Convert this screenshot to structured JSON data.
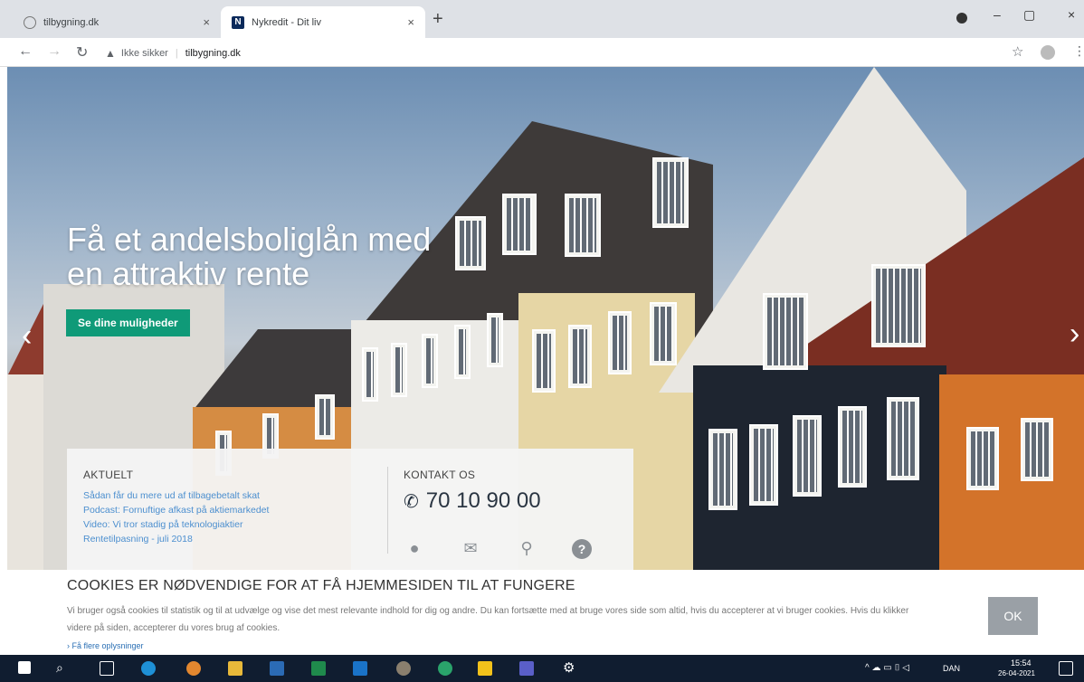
{
  "browser": {
    "tabs": [
      {
        "title": "tilbygning.dk",
        "active": false
      },
      {
        "title": "Nykredit - Dit liv",
        "active": true
      }
    ],
    "new_tab": "+",
    "close_glyph": "×",
    "window_controls": {
      "minimize": "–",
      "restore": "▢",
      "close": "×"
    },
    "security_warning": "Ikke sikker",
    "url": "tilbygning.dk",
    "favicon_n": "N"
  },
  "hero": {
    "title": "Få et andelsboliglån med en attraktiv rente",
    "cta": "Se dine muligheder",
    "prev": "‹",
    "next": "›"
  },
  "aktuelt": {
    "heading": "AKTUELT",
    "items": [
      "Sådan får du mere ud af tilbagebetalt skat",
      "Podcast: Fornuftige afkast på aktiemarkedet",
      "Video: Vi tror stadig på teknologiaktier",
      "Rentetilpasning - juli 2018"
    ]
  },
  "kontakt": {
    "heading": "KONTAKT OS",
    "phone": "70 10 90 00"
  },
  "cookie": {
    "title": "COOKIES ER NØDVENDIGE FOR AT FÅ HJEMMESIDEN TIL AT FUNGERE",
    "text": "Vi bruger også cookies til statistik og til at udvælge og vise det mest relevante indhold for dig og andre. Du kan fortsætte med at bruge vores side som altid, hvis du accepterer at vi bruger cookies. Hvis du klikker videre på siden, accepterer du vores brug af cookies.",
    "more": "Få flere oplysninger",
    "ok": "OK"
  },
  "taskbar": {
    "language": "DAN",
    "time": "15:54",
    "date": "26-04-2021"
  },
  "colors": {
    "cta_green": "#0f9a78",
    "link_blue": "#4c8fcf",
    "taskbar": "#101d30"
  }
}
